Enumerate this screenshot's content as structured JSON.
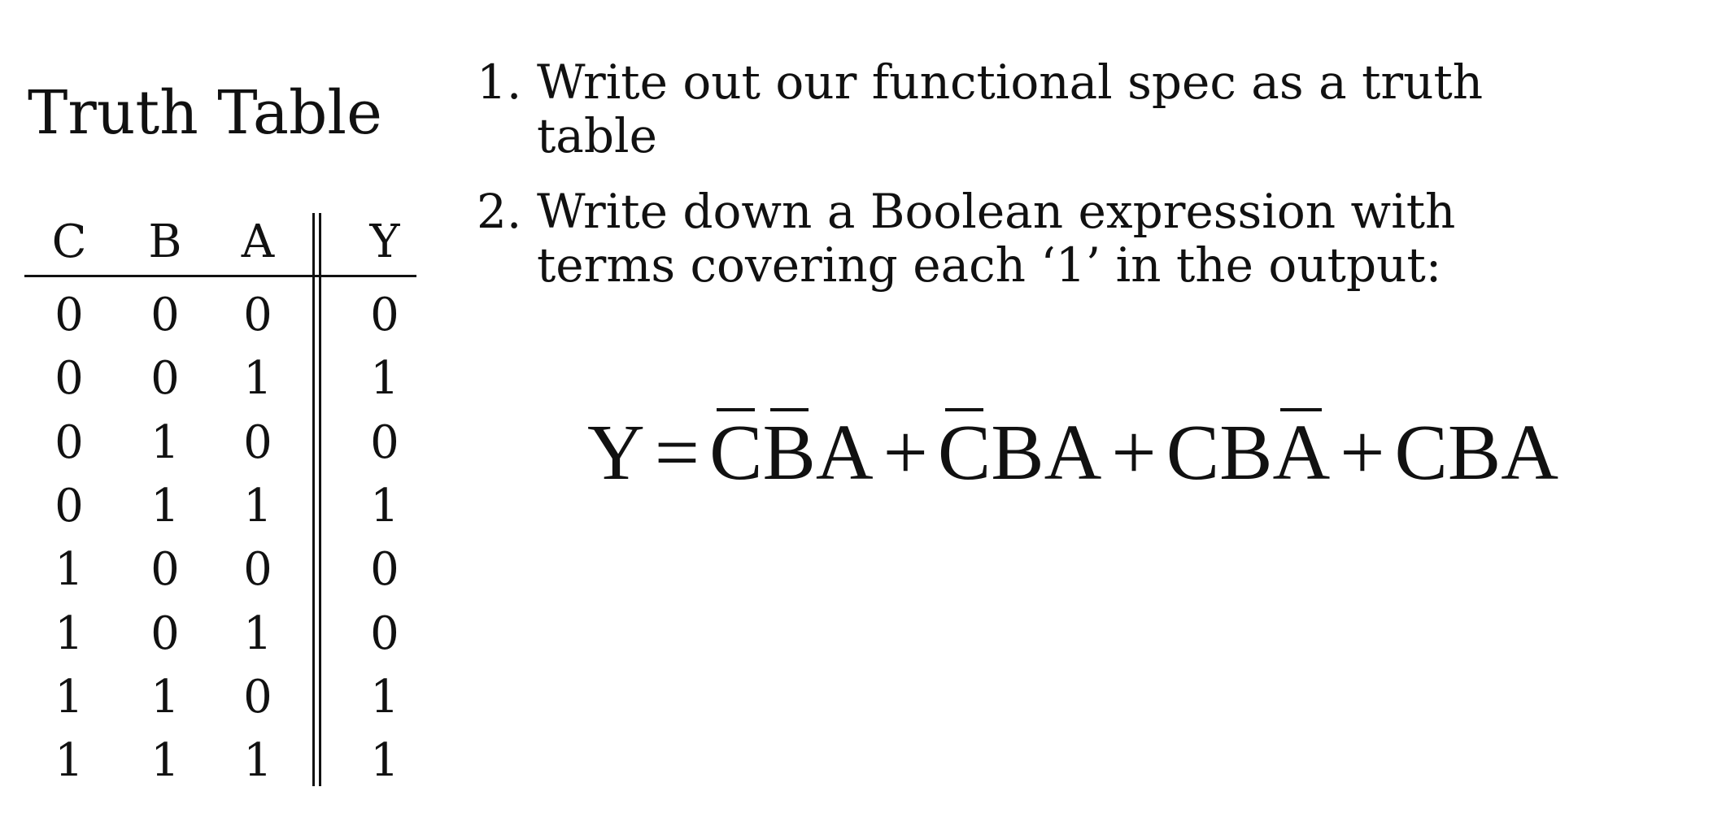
{
  "title": "Truth Table",
  "truth_table": {
    "headers": [
      "C",
      "B",
      "A",
      "Y"
    ],
    "rows": [
      [
        "0",
        "0",
        "0",
        "0"
      ],
      [
        "0",
        "0",
        "1",
        "1"
      ],
      [
        "0",
        "1",
        "0",
        "0"
      ],
      [
        "0",
        "1",
        "1",
        "1"
      ],
      [
        "1",
        "0",
        "0",
        "0"
      ],
      [
        "1",
        "0",
        "1",
        "0"
      ],
      [
        "1",
        "1",
        "0",
        "1"
      ],
      [
        "1",
        "1",
        "1",
        "1"
      ]
    ]
  },
  "steps": [
    {
      "number": "1.",
      "text": "Write out our functional spec as a truth table"
    },
    {
      "number": "2.",
      "text": "Write down a Boolean expression with terms covering  each ‘1’ in the output:"
    }
  ],
  "equation": {
    "lhs": "Y",
    "equals": "=",
    "plus": "+",
    "terms": [
      [
        {
          "var": "C",
          "negated": true
        },
        {
          "var": "B",
          "negated": true
        },
        {
          "var": "A",
          "negated": false
        }
      ],
      [
        {
          "var": "C",
          "negated": true
        },
        {
          "var": "B",
          "negated": false
        },
        {
          "var": "A",
          "negated": false
        }
      ],
      [
        {
          "var": "C",
          "negated": false
        },
        {
          "var": "B",
          "negated": false
        },
        {
          "var": "A",
          "negated": true
        }
      ],
      [
        {
          "var": "C",
          "negated": false
        },
        {
          "var": "B",
          "negated": false
        },
        {
          "var": "A",
          "negated": false
        }
      ]
    ]
  }
}
